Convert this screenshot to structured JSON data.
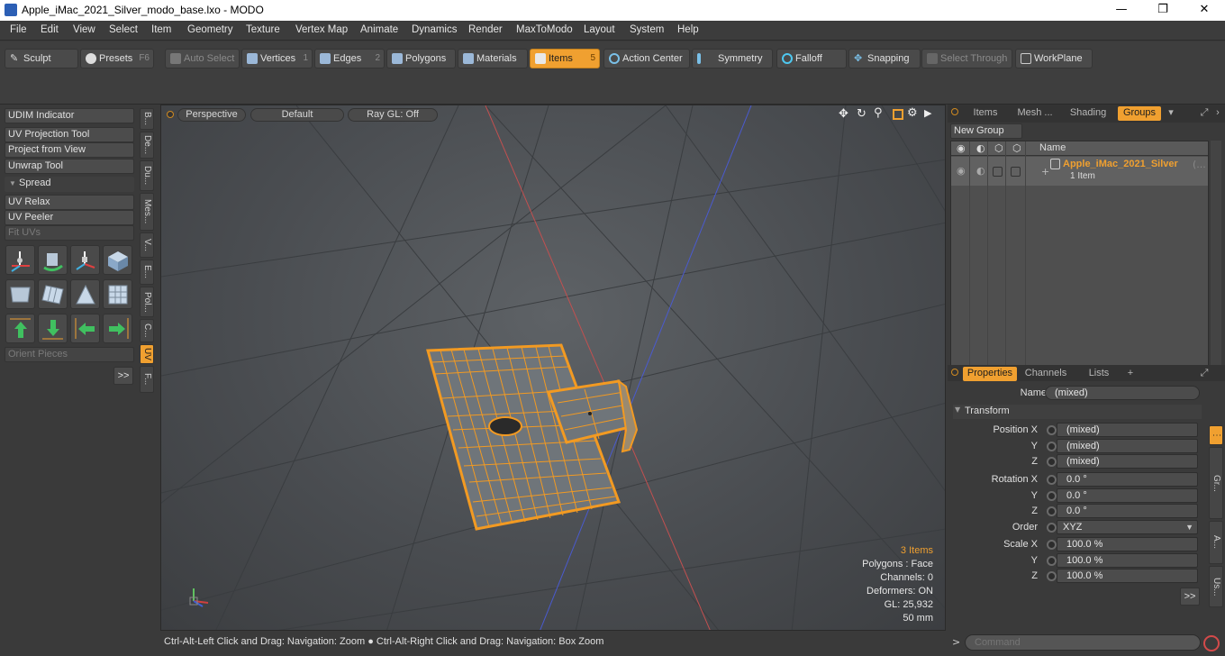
{
  "window": {
    "title": "Apple_iMac_2021_Silver_modo_base.lxo - MODO",
    "minimize": "—",
    "maximize": "❐",
    "close": "✕"
  },
  "menu": [
    "File",
    "Edit",
    "View",
    "Select",
    "Item",
    "Geometry",
    "Texture",
    "Vertex Map",
    "Animate",
    "Dynamics",
    "Render",
    "MaxToModo",
    "Layout",
    "System",
    "Help"
  ],
  "toolbar": {
    "sculpt": "Sculpt",
    "presets": "Presets",
    "presets_key": "F6",
    "auto_select": "Auto Select",
    "vertices": "Vertices",
    "vertices_key": "1",
    "edges": "Edges",
    "edges_key": "2",
    "polygons": "Polygons",
    "materials": "Materials",
    "items": "Items",
    "items_key": "5",
    "action_center": "Action Center",
    "symmetry": "Symmetry",
    "falloff": "Falloff",
    "snapping": "Snapping",
    "select_through": "Select Through",
    "workplane": "WorkPlane"
  },
  "left": {
    "udim": "UDIM Indicator",
    "uv_projection": "UV Projection Tool",
    "project_view": "Project from View",
    "unwrap": "Unwrap Tool",
    "spread": "Spread",
    "uv_relax": "UV Relax",
    "uv_peeler": "UV Peeler",
    "fit_uvs": "Fit UVs",
    "orient": "Orient Pieces",
    "more": ">>",
    "vtabs": [
      "B...",
      "De...",
      "Du...",
      "Mes...",
      "V...",
      "E...",
      "Pol...",
      "C...",
      "UV",
      "F..."
    ]
  },
  "viewport": {
    "view": "Perspective",
    "shading": "Default",
    "raygl": "Ray GL: Off",
    "info": {
      "items": "3 Items",
      "polygons": "Polygons : Face",
      "channels": "Channels: 0",
      "deformers": "Deformers: ON",
      "gl": "GL: 25,932",
      "scale": "50 mm"
    }
  },
  "status": "Ctrl-Alt-Left Click and Drag: Navigation: Zoom ● Ctrl-Alt-Right Click and Drag: Navigation: Box Zoom",
  "groups_panel": {
    "tabs": [
      "Items",
      "Mesh ...",
      "Shading",
      "Groups"
    ],
    "new_group": "New Group",
    "col_name": "Name",
    "row_name": "Apple_iMac_2021_Silver",
    "row_suffix": "(...",
    "row_sub": "1 Item"
  },
  "properties": {
    "tabs": [
      "Properties",
      "Channels",
      "Lists",
      "+"
    ],
    "name_label": "Name",
    "name_value": "(mixed)",
    "transform": "Transform",
    "rows": [
      {
        "label": "Position X",
        "value": "(mixed)"
      },
      {
        "label": "Y",
        "value": "(mixed)"
      },
      {
        "label": "Z",
        "value": "(mixed)"
      },
      {
        "label": "Rotation X",
        "value": "0.0 °"
      },
      {
        "label": "Y",
        "value": "0.0 °"
      },
      {
        "label": "Z",
        "value": "0.0 °"
      }
    ],
    "order_label": "Order",
    "order_value": "XYZ",
    "scale_rows": [
      {
        "label": "Scale X",
        "value": "100.0 %"
      },
      {
        "label": "Y",
        "value": "100.0 %"
      },
      {
        "label": "Z",
        "value": "100.0 %"
      }
    ],
    "side_tabs": [
      "Gr...",
      "A...",
      "Us..."
    ],
    "more": ">>"
  },
  "command": {
    "placeholder": "Command",
    "prompt": ">"
  },
  "colors": {
    "accent": "#f0a030",
    "viewport_bg": "#4e5155",
    "panel": "#3a3a3a"
  }
}
